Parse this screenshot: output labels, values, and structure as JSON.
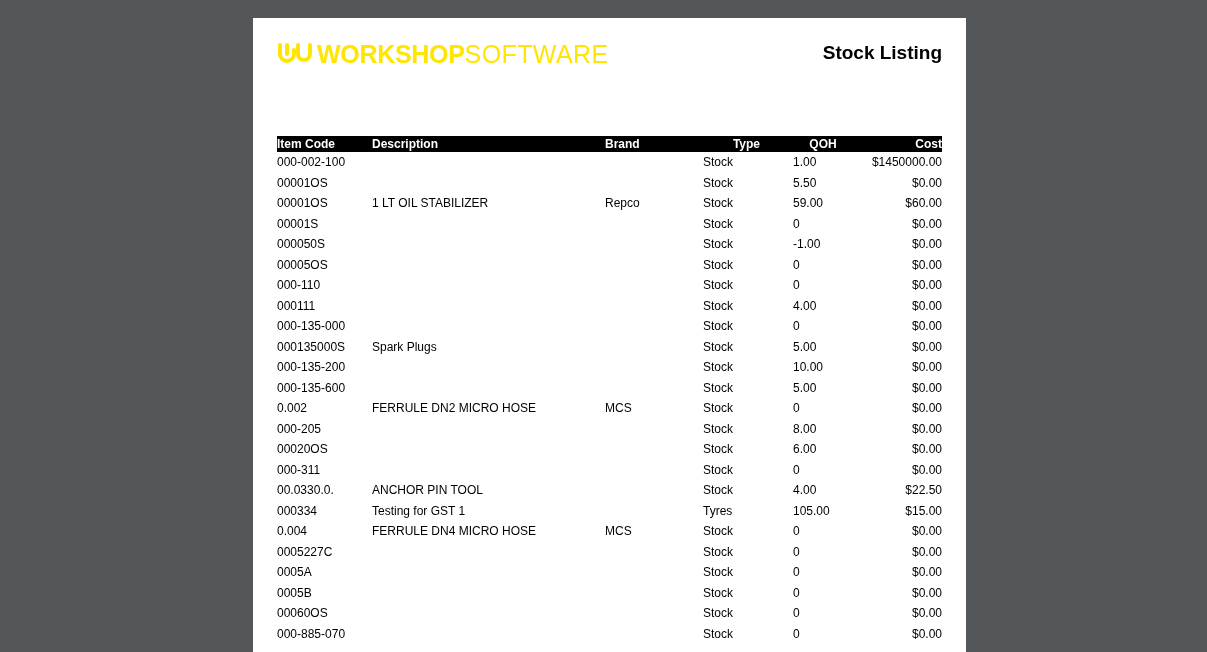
{
  "document": {
    "logo": {
      "bold": "WORKSHOP",
      "light": "SOFTWARE"
    },
    "title": "Stock Listing",
    "table": {
      "columns": [
        "Item Code",
        "Description",
        "Brand",
        "Type",
        "QOH",
        "Cost"
      ],
      "rows": [
        [
          "000-002-100",
          "",
          "",
          "Stock",
          "1.00",
          "$1450000.00"
        ],
        [
          "00001OS",
          "",
          "",
          "Stock",
          "5.50",
          "$0.00"
        ],
        [
          "00001OS",
          "1 LT OIL STABILIZER",
          "Repco",
          "Stock",
          "59.00",
          "$60.00"
        ],
        [
          "00001S",
          "",
          "",
          "Stock",
          "0",
          "$0.00"
        ],
        [
          "000050S",
          "",
          "",
          "Stock",
          "-1.00",
          "$0.00"
        ],
        [
          "00005OS",
          "",
          "",
          "Stock",
          "0",
          "$0.00"
        ],
        [
          "000-110",
          "",
          "",
          "Stock",
          "0",
          "$0.00"
        ],
        [
          "000111",
          "",
          "",
          "Stock",
          "4.00",
          "$0.00"
        ],
        [
          "000-135-000",
          "",
          "",
          "Stock",
          "0",
          "$0.00"
        ],
        [
          "000135000S",
          "Spark Plugs",
          "",
          "Stock",
          "5.00",
          "$0.00"
        ],
        [
          "000-135-200",
          "",
          "",
          "Stock",
          "10.00",
          "$0.00"
        ],
        [
          "000-135-600",
          "",
          "",
          "Stock",
          "5.00",
          "$0.00"
        ],
        [
          "0.002",
          "FERRULE DN2 MICRO HOSE",
          "MCS",
          "Stock",
          "0",
          "$0.00"
        ],
        [
          "000-205",
          "",
          "",
          "Stock",
          "8.00",
          "$0.00"
        ],
        [
          "00020OS",
          "",
          "",
          "Stock",
          "6.00",
          "$0.00"
        ],
        [
          "000-311",
          "",
          "",
          "Stock",
          "0",
          "$0.00"
        ],
        [
          "00.0330.0.",
          "ANCHOR PIN TOOL",
          "",
          "Stock",
          "4.00",
          "$22.50"
        ],
        [
          "000334",
          "Testing for GST 1",
          "",
          "Tyres",
          "105.00",
          "$15.00"
        ],
        [
          "0.004",
          "FERRULE DN4 MICRO HOSE",
          "MCS",
          "Stock",
          "0",
          "$0.00"
        ],
        [
          "0005227C",
          "",
          "",
          "Stock",
          "0",
          "$0.00"
        ],
        [
          "0005A",
          "",
          "",
          "Stock",
          "0",
          "$0.00"
        ],
        [
          "0005B",
          "",
          "",
          "Stock",
          "0",
          "$0.00"
        ],
        [
          "00060OS",
          "",
          "",
          "Stock",
          "0",
          "$0.00"
        ],
        [
          "000-885-070",
          "",
          "",
          "Stock",
          "0",
          "$0.00"
        ]
      ]
    }
  }
}
